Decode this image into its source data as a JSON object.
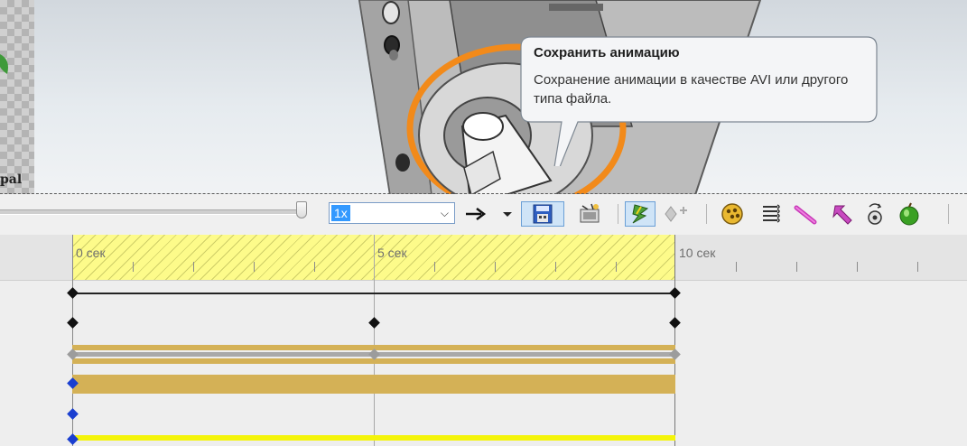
{
  "viewport": {
    "partial_label": "pal"
  },
  "tooltip": {
    "title": "Сохранить анимацию",
    "body": "Сохранение анимации в качестве AVI или другого типа файла."
  },
  "toolbar": {
    "speed_value": "1x",
    "icons": [
      "play-direction-arrow-icon",
      "dropdown-arrow-icon",
      "save-animation-icon",
      "animation-wizard-icon",
      "lightning-icon",
      "add-key-icon",
      "calculate-icon",
      "list-icon",
      "pencil-icon",
      "pointer-icon",
      "motor-icon",
      "apple-icon"
    ]
  },
  "timeline": {
    "ruler_labels": [
      "0 сек",
      "5 сек",
      "10 сек"
    ],
    "highlight_color": "#fdfb8a",
    "bar_color": "#d4b156",
    "key_color": "#1a3fd0"
  }
}
